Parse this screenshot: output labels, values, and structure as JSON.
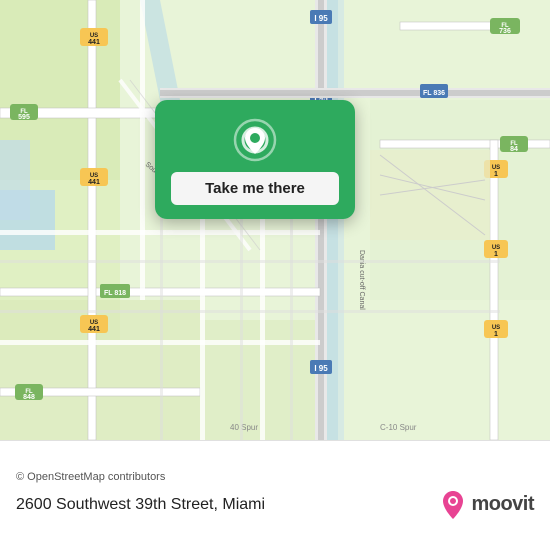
{
  "map": {
    "attribution": "© OpenStreetMap contributors",
    "background_color": "#e8f0d8"
  },
  "popup": {
    "button_label": "Take me there",
    "pin_icon": "location-pin"
  },
  "address": {
    "text": "2600 Southwest 39th Street, Miami"
  },
  "branding": {
    "name": "moovit",
    "pin_icon": "moovit-pin-icon"
  },
  "roads": {
    "highway_color": "#f7c654",
    "road_color": "#ffffff",
    "interstate_color": "#4a90d9",
    "water_color": "#b8d9e8"
  }
}
